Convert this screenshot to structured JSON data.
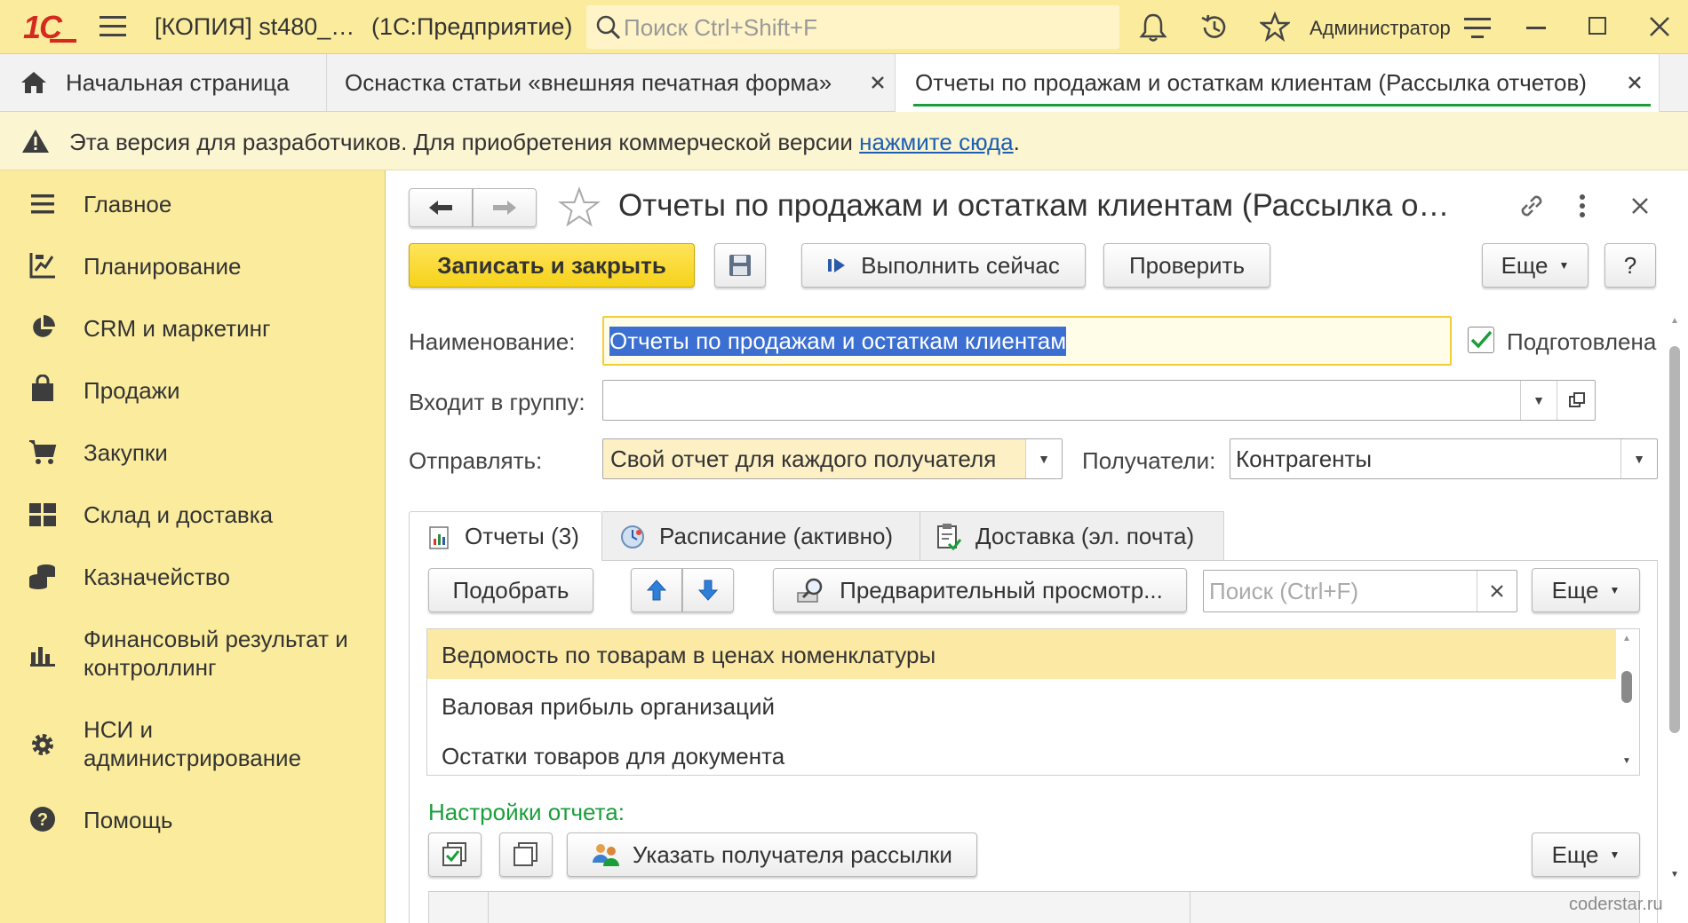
{
  "titlebar": {
    "logo": "1С",
    "title": "[КОПИЯ] st480_…",
    "app_name": "(1С:Предприятие)",
    "search_placeholder": "Поиск Ctrl+Shift+F",
    "user": "Администратор"
  },
  "tabs": [
    {
      "label": "Начальная страница"
    },
    {
      "label": "Оснастка статьи «внешняя печатная форма»"
    },
    {
      "label": "Отчеты по продажам и остаткам клиентам (Рассылка отчетов)"
    }
  ],
  "banner": {
    "text": "Эта версия для разработчиков. Для приобретения коммерческой версии ",
    "link": "нажмите сюда",
    "suffix": "."
  },
  "sidebar": {
    "items": [
      {
        "label": "Главное",
        "icon": "menu-icon"
      },
      {
        "label": "Планирование",
        "icon": "planning-icon"
      },
      {
        "label": "CRM и маркетинг",
        "icon": "pie-chart-icon"
      },
      {
        "label": "Продажи",
        "icon": "shopping-bag-icon"
      },
      {
        "label": "Закупки",
        "icon": "cart-icon"
      },
      {
        "label": "Склад и доставка",
        "icon": "warehouse-icon"
      },
      {
        "label": "Казначейство",
        "icon": "coins-icon"
      },
      {
        "label": "Финансовый результат и",
        "label2": "контроллинг",
        "icon": "bar-chart-icon"
      },
      {
        "label": "НСИ и",
        "label2": "администрирование",
        "icon": "gear-icon"
      },
      {
        "label": "Помощь",
        "icon": "help-icon"
      }
    ]
  },
  "form": {
    "title": "Отчеты по продажам и остаткам клиентам (Рассылка о…",
    "toolbar": {
      "save_close": "Записать и закрыть",
      "run_now": "Выполнить сейчас",
      "check": "Проверить",
      "more": "Еще",
      "help": "?"
    },
    "name_label": "Наименование:",
    "name_value": "Отчеты по продажам и остаткам клиентам",
    "prepared_label": "Подготовлена",
    "group_label": "Входит в группу:",
    "group_value": "",
    "send_label": "Отправлять:",
    "send_value": "Свой отчет для каждого получателя",
    "recipients_label": "Получатели:",
    "recipients_value": "Контрагенты"
  },
  "inner_tabs": [
    {
      "label": "Отчеты (3)"
    },
    {
      "label": "Расписание (активно)"
    },
    {
      "label": "Доставка (эл. почта)"
    }
  ],
  "reports_toolbar": {
    "pick": "Подобрать",
    "preview": "Предварительный просмотр...",
    "search_placeholder": "Поиск (Ctrl+F)",
    "more": "Еще"
  },
  "reports": [
    {
      "name": "Ведомость по товарам в ценах номенклатуры"
    },
    {
      "name": "Валовая прибыль организаций"
    },
    {
      "name": "Остатки товаров для документа"
    }
  ],
  "settings": {
    "label": "Настройки отчета:",
    "recipient_btn": "Указать получателя рассылки",
    "more": "Еще"
  },
  "watermark": "coderstar.ru",
  "colors": {
    "accent_yellow": "#fbec9d",
    "selection": "#fce9a3",
    "green": "#1a9e3a"
  }
}
